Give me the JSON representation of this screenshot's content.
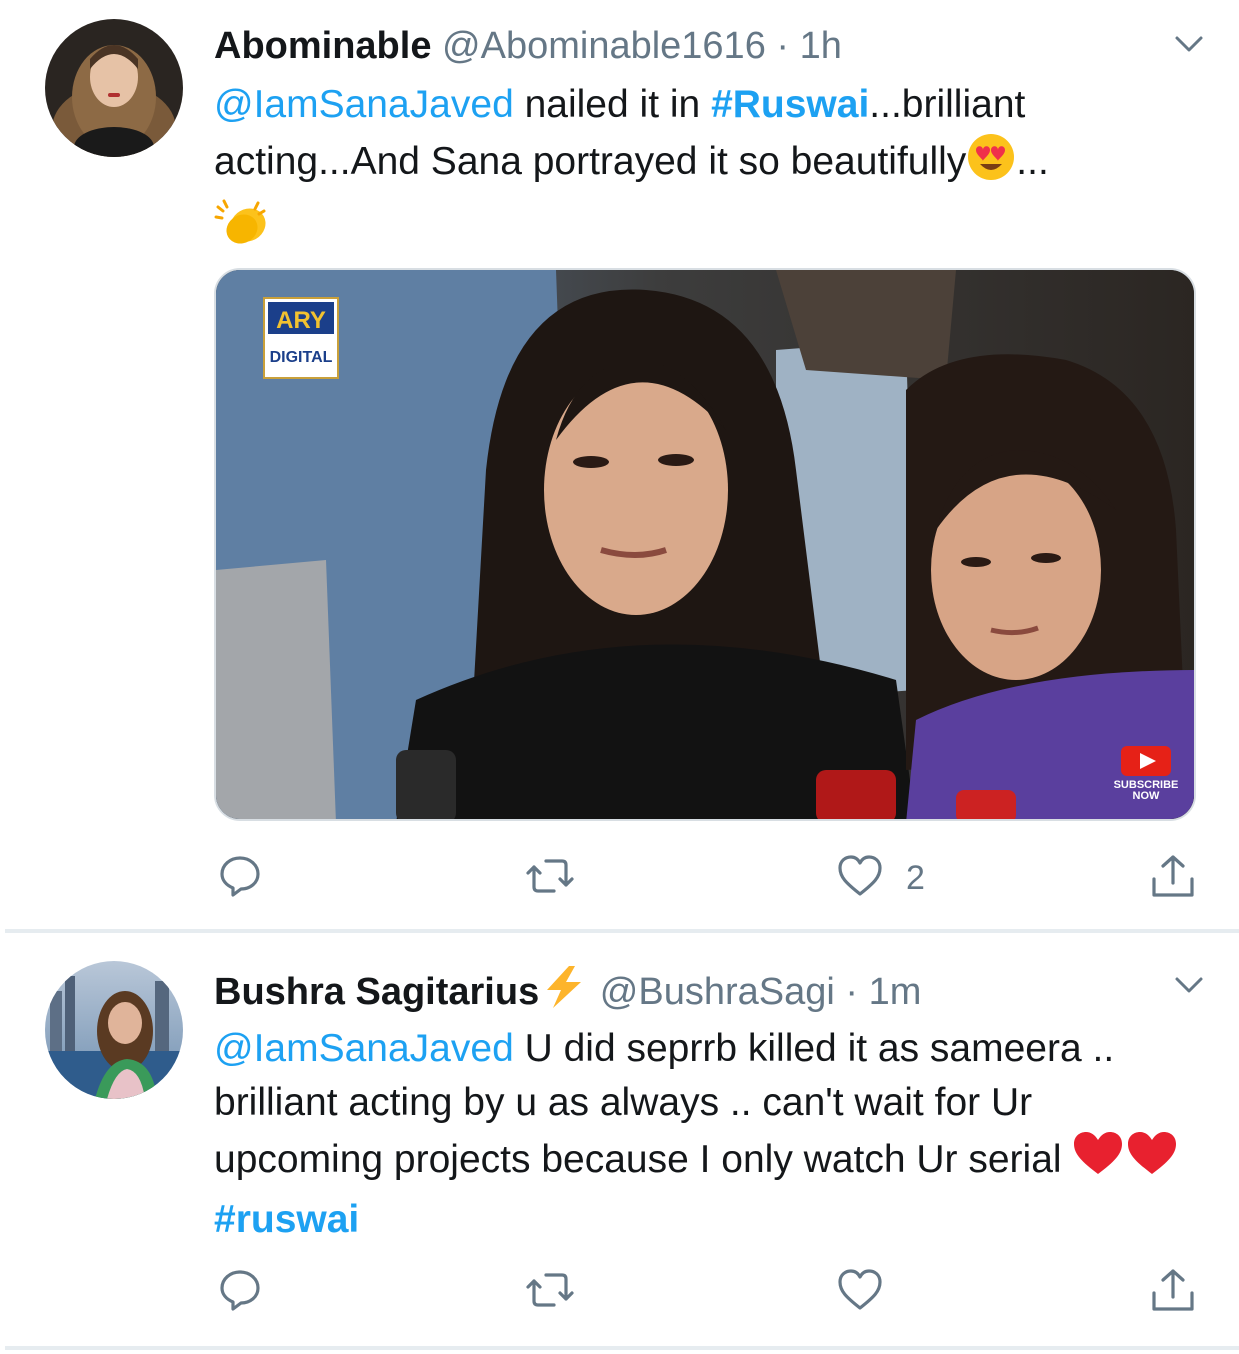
{
  "tweets": [
    {
      "display_name": "Abominable",
      "handle": "@Abominable1616",
      "separator": "·",
      "time": "1h",
      "mention": "@IamSanaJaved",
      "text_1": " nailed it in ",
      "hashtag": "#Ruswai",
      "text_2": "...brilliant acting...And Sana portrayed it so beautifully",
      "text_3": "...",
      "emoji_1": "smiling-face-with-heart-eyes",
      "emoji_2": "clapping-hands",
      "media": {
        "logo_top": "ARY",
        "logo_bottom": "DIGITAL",
        "subscribe_1": "SUBSCRIBE",
        "subscribe_2": "NOW"
      },
      "actions": {
        "reply_count": "",
        "retweet_count": "",
        "like_count": "2"
      }
    },
    {
      "display_name": "Bushra Sagitarius",
      "name_emoji": "high-voltage",
      "handle": "@BushraSagi",
      "separator": "·",
      "time": "1m",
      "mention": "@IamSanaJaved",
      "text_1": " U did seprrb killed it as sameera .. brilliant acting by u as always .. can't wait for Ur upcoming projects because I only watch Ur serial ",
      "emoji_1": "red-heart",
      "hashtag": "#ruswai",
      "actions": {
        "reply_count": "",
        "retweet_count": "",
        "like_count": ""
      }
    }
  ],
  "colors": {
    "link": "#1da1f2",
    "secondary_text": "#657786",
    "divider": "#e6ecf0"
  }
}
